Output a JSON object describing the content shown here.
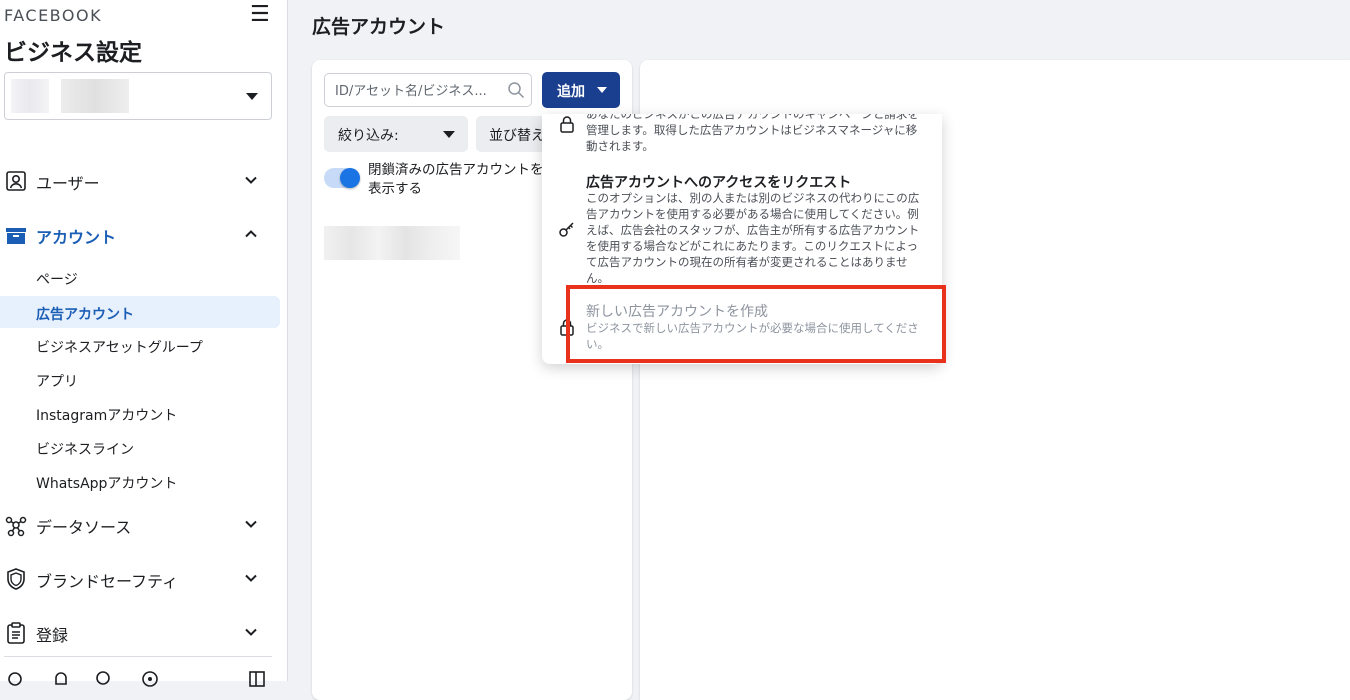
{
  "sidebar": {
    "brand": "FACEBOOK",
    "title": "ビジネス設定",
    "nav": {
      "users": "ユーザー",
      "accounts": "アカウント",
      "data_sources": "データソース",
      "brand_safety": "ブランドセーフティ",
      "registration": "登録"
    },
    "account_items": [
      {
        "label": "ページ"
      },
      {
        "label": "広告アカウント"
      },
      {
        "label": "ビジネスアセットグループ"
      },
      {
        "label": "アプリ"
      },
      {
        "label": "Instagramアカウント"
      },
      {
        "label": "ビジネスライン"
      },
      {
        "label": "WhatsAppアカウント"
      }
    ],
    "active_item": "広告アカウント"
  },
  "main": {
    "page_title": "広告アカウント",
    "search_placeholder": "ID/アセット名/ビジネス...",
    "add_label": "追加",
    "filter_label": "絞り込み:",
    "sort_label": "並び替え",
    "toggle_label": "閉鎖済みの広告アカウントを表示する",
    "toggle_on": true
  },
  "dropdown": {
    "options": [
      {
        "title": "",
        "desc": "あなたのビジネスがこの広告アカウントのキャンペーンと請求を管理します。取得した広告アカウントはビジネスマネージャに移動されます。",
        "icon": "lock-icon"
      },
      {
        "title": "広告アカウントへのアクセスをリクエスト",
        "desc": "このオプションは、別の人または別のビジネスの代わりにこの広告アカウントを使用する必要がある場合に使用してください。例えば、広告会社のスタッフが、広告主が所有する広告アカウントを使用する場合などがこれにあたります。このリクエストによって広告アカウントの現在の所有者が変更されることはありません。",
        "icon": "key-icon"
      },
      {
        "title": "新しい広告アカウントを作成",
        "desc": "ビジネスで新しい広告アカウントが必要な場合に使用してください。",
        "icon": "lock-icon",
        "disabled": true
      }
    ]
  },
  "colors": {
    "accent": "#1b5eb5",
    "button": "#1b3f8f",
    "highlight": "#e8321c"
  }
}
